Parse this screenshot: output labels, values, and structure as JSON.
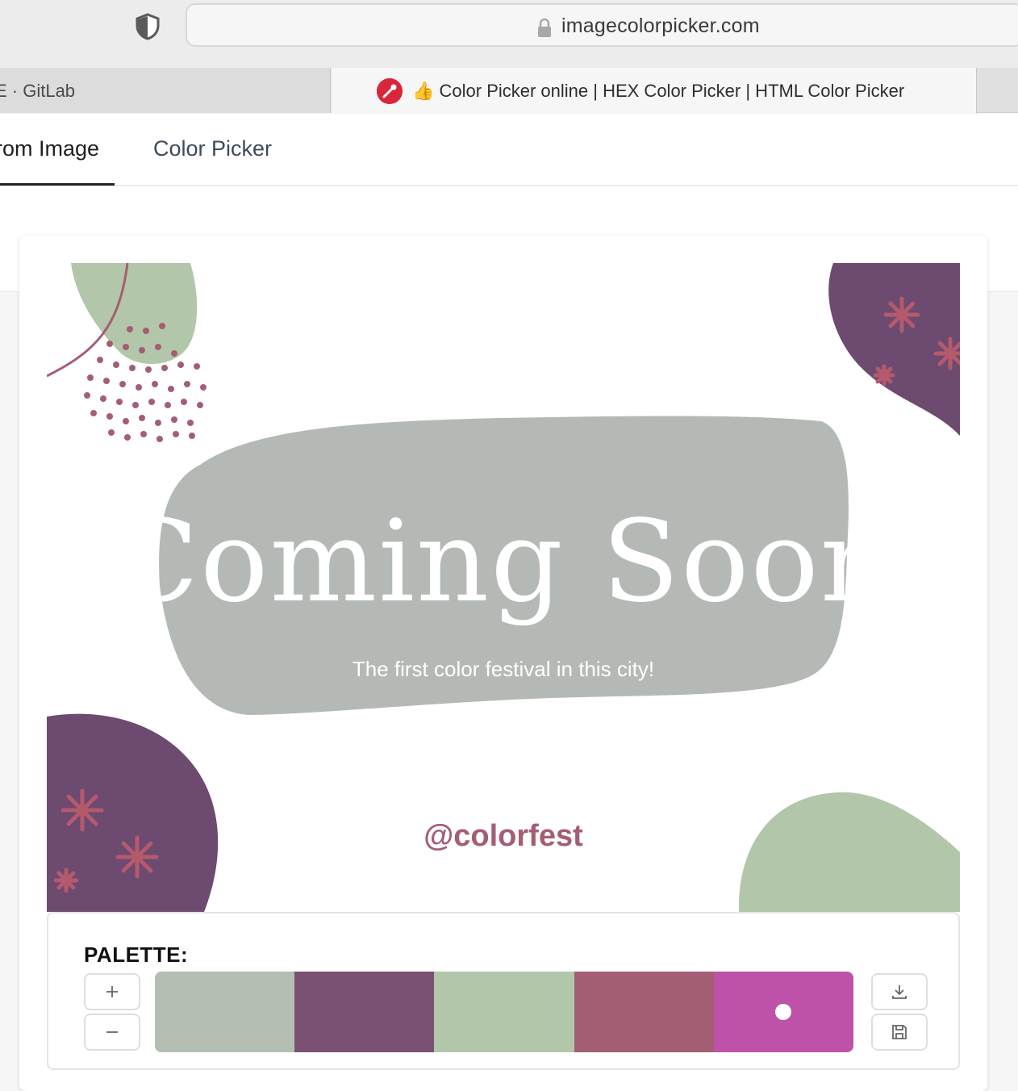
{
  "browser": {
    "url": "imagecolorpicker.com",
    "tabs": [
      {
        "title": "E · GitLab"
      },
      {
        "title": "👍 Color Picker online | HEX Color Picker | HTML Color Picker",
        "active": true
      }
    ]
  },
  "nav": {
    "tabs": [
      {
        "label": "rom Image",
        "active": true
      },
      {
        "label": "Color Picker",
        "active": false
      }
    ]
  },
  "poster": {
    "headline": "Coming Soon",
    "subtitle": "The first color festival in this city!",
    "handle": "@colorfest"
  },
  "palette": {
    "label": "PALETTE:",
    "add_icon": "plus-icon",
    "remove_icon": "minus-icon",
    "download_icon": "download-icon",
    "save_icon": "save-icon",
    "colors": [
      "#b3bdb2",
      "#7a5073",
      "#b2c7aa",
      "#a45e72",
      "#bd52a8"
    ],
    "selected_index": 4
  }
}
